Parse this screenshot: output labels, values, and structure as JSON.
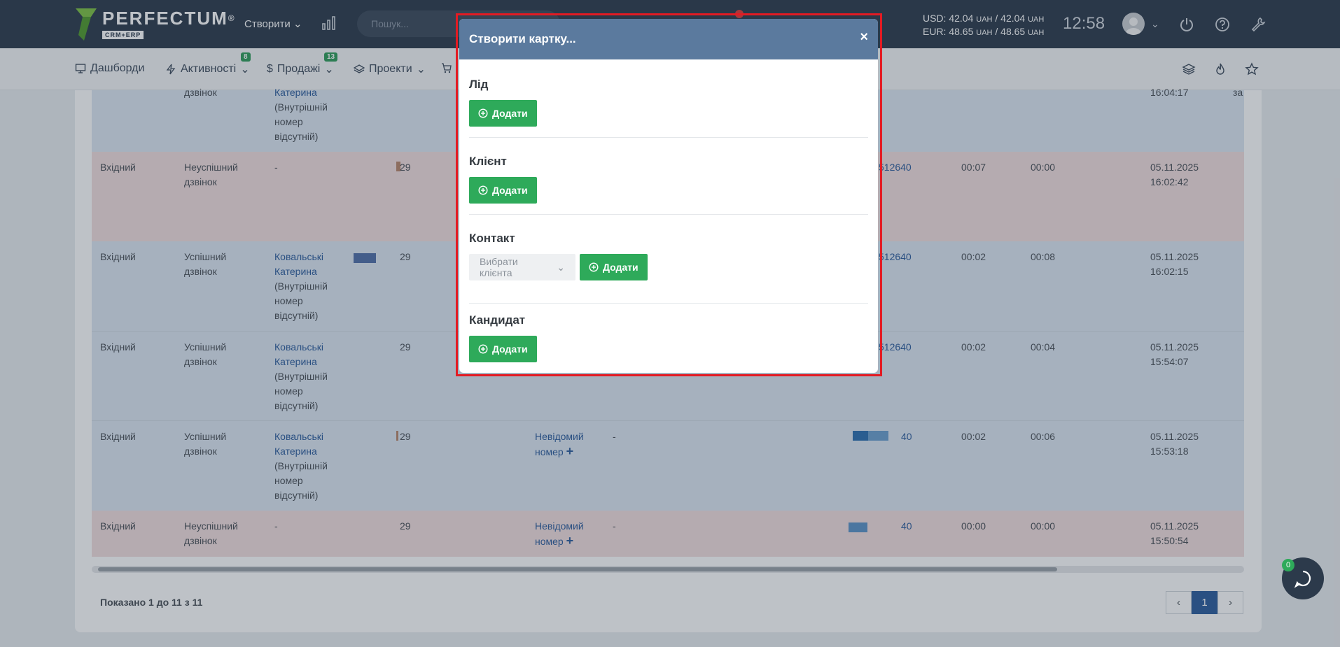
{
  "topbar": {
    "logo_name": "PERFECTUM",
    "logo_reg": "®",
    "logo_sub": "CRM+ERP",
    "create_label": "Створити",
    "search_placeholder": "Пошук...",
    "currency_usd": "USD: 42.04",
    "currency_usd_2": "42.04",
    "currency_eur": "EUR: 48.65",
    "currency_eur_2": "48.65",
    "currency_unit": "UAH",
    "clock": "12:58"
  },
  "menubar": {
    "items": [
      {
        "label": "Дашборди"
      },
      {
        "label": "Активності",
        "badge": "8"
      },
      {
        "label": "Продажі",
        "badge": "13"
      },
      {
        "label": "Проекти"
      }
    ]
  },
  "table": {
    "rows": [
      {
        "type": "",
        "status": "дзвінок",
        "employee": [
          "Катерина",
          "(Внутрішній",
          "номер",
          "відсутній)"
        ],
        "num": "",
        "num2": "",
        "dur1": "",
        "dur2": "",
        "date": "16:04:17",
        "extra": "за"
      },
      {
        "type": "Вхідний",
        "status": "Неуспішний дзвінок",
        "employee": [
          "-"
        ],
        "num": "29",
        "num2": "512640",
        "dur1": "00:07",
        "dur2": "00:00",
        "date": "05.11.2025",
        "time": "16:02:42"
      },
      {
        "type": "Вхідний",
        "status": "Успішний дзвінок",
        "employee": [
          "Ковальські",
          "Катерина",
          "(Внутрішній",
          "номер",
          "відсутній)"
        ],
        "num": "29",
        "num2": "512640",
        "dur1": "00:02",
        "dur2": "00:08",
        "date": "05.11.2025",
        "time": "16:02:15"
      },
      {
        "type": "Вхідний",
        "status": "Успішний дзвінок",
        "employee": [
          "Ковальські",
          "Катерина",
          "(Внутрішній",
          "номер",
          "відсутній)"
        ],
        "num": "29",
        "num2": "512640",
        "dur1": "00:02",
        "dur2": "00:04",
        "date": "05.11.2025",
        "time": "15:54:07"
      },
      {
        "type": "Вхідний",
        "status": "Успішний дзвінок",
        "employee": [
          "Ковальські",
          "Катерина",
          "(Внутрішній",
          "номер",
          "відсутній)"
        ],
        "num": "29",
        "unknown": [
          "Невідомий",
          "номер"
        ],
        "dash": "-",
        "num2": "40",
        "dur1": "00:02",
        "dur2": "00:06",
        "date": "05.11.2025",
        "time": "15:53:18"
      },
      {
        "type": "Вхідний",
        "status": "Неуспішний дзвінок",
        "employee": [
          "-"
        ],
        "num": "29",
        "unknown": [
          "Невідомий",
          "номер"
        ],
        "dash": "-",
        "num2": "40",
        "dur1": "00:00",
        "dur2": "00:00",
        "date": "05.11.2025",
        "time": "15:50:54"
      }
    ],
    "footer": "Показано 1 до 11 з 11",
    "pager": {
      "prev": "‹",
      "page": "1",
      "next": "›"
    }
  },
  "modal": {
    "title": "Створити картку...",
    "close": "×",
    "sections": [
      {
        "title": "Лід",
        "button": "Додати"
      },
      {
        "title": "Клієнт",
        "button": "Додати"
      },
      {
        "title": "Контакт",
        "select": "Вибрати клієнта",
        "button": "Додати"
      },
      {
        "title": "Кандидат",
        "button": "Додати"
      }
    ]
  },
  "chat": {
    "badge": "0"
  },
  "colors": {
    "primary": "#2c3a4b",
    "accent_green": "#2eaa5a",
    "modal_header": "#5b7a9e",
    "highlight_red": "#e31b23",
    "link": "#2c5c9c"
  }
}
